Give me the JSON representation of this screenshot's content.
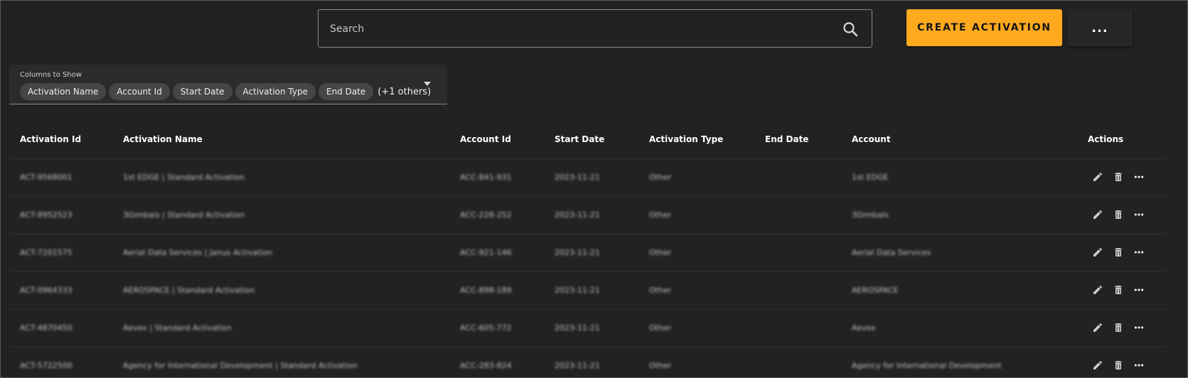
{
  "search": {
    "placeholder": "Search"
  },
  "toolbar": {
    "create_label": "CREATE ACTIVATION",
    "more_label": "..."
  },
  "columns_selector": {
    "label": "Columns to Show",
    "chips": [
      "Activation Name",
      "Account Id",
      "Start Date",
      "Activation Type",
      "End Date"
    ],
    "others_label": "(+1 others)"
  },
  "table": {
    "headers": [
      "Activation Id",
      "Activation Name",
      "Account Id",
      "Start Date",
      "Activation Type",
      "End Date",
      "Account",
      "Actions"
    ],
    "rows": [
      {
        "id": "ACT-9568001",
        "name": "1st EDGE | Standard Activation",
        "account_id": "ACC-841-931",
        "start": "2023-11-21",
        "type": "Other",
        "end": "",
        "account": "1st EDGE"
      },
      {
        "id": "ACT-8952523",
        "name": "3Gimbals | Standard Activation",
        "account_id": "ACC-228-252",
        "start": "2023-11-21",
        "type": "Other",
        "end": "",
        "account": "3Gimbals"
      },
      {
        "id": "ACT-7201575",
        "name": "Aerial Data Services | Janus Activation",
        "account_id": "ACC-921-146",
        "start": "2023-11-21",
        "type": "Other",
        "end": "",
        "account": "Aerial Data Services"
      },
      {
        "id": "ACT-0964333",
        "name": "AEROSPACE | Standard Activation",
        "account_id": "ACC-898-189",
        "start": "2023-11-21",
        "type": "Other",
        "end": "",
        "account": "AEROSPACE"
      },
      {
        "id": "ACT-4870450",
        "name": "Aevex | Standard Activation",
        "account_id": "ACC-605-772",
        "start": "2023-11-21",
        "type": "Other",
        "end": "",
        "account": "Aevex"
      },
      {
        "id": "ACT-5722500",
        "name": "Agency for International Development | Standard Activation",
        "account_id": "ACC-283-824",
        "start": "2023-11-21",
        "type": "Other",
        "end": "",
        "account": "Agency for International Development"
      }
    ]
  },
  "icons": {
    "search": "search-icon",
    "edit": "pencil-icon",
    "delete": "trash-icon",
    "more": "more-horizontal-icon",
    "dropdown": "chevron-down-icon"
  },
  "colors": {
    "background": "#222222",
    "accent": "#ffa91f",
    "chip": "#464646"
  }
}
